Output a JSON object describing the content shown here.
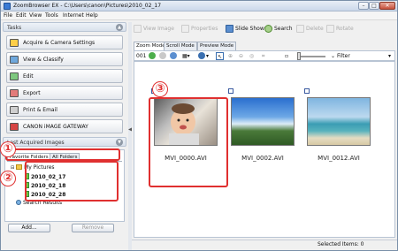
{
  "window": {
    "title": "ZoomBrowser EX - C:\\Users\\canon\\Pictures\\2010_02_17",
    "controls": {
      "minimize": "–",
      "maximize": "□",
      "close": "✕"
    }
  },
  "menu": [
    "File",
    "Edit",
    "View",
    "Tools",
    "Internet",
    "Help"
  ],
  "tasks": {
    "header": "Tasks",
    "items": [
      {
        "label": "Acquire & Camera Settings",
        "icon": "camera-icon"
      },
      {
        "label": "View & Classify",
        "icon": "view-classify-icon"
      },
      {
        "label": "Edit",
        "icon": "edit-icon"
      },
      {
        "label": "Export",
        "icon": "export-icon"
      },
      {
        "label": "Print & Email",
        "icon": "printer-icon"
      },
      {
        "label": "CANON iMAGE GATEWAY",
        "icon": "gateway-icon"
      }
    ]
  },
  "last_acquired": {
    "header": "Last Acquired Images"
  },
  "folders": {
    "tabs": [
      "Favorite Folders",
      "All Folders"
    ],
    "tree": {
      "root": "My Pictures",
      "children": [
        "2010_02_17",
        "2010_02_18",
        "2010_02_28"
      ],
      "search": "Search Results"
    },
    "add_label": "Add...",
    "remove_label": "Remove"
  },
  "toolbar": {
    "view_image": "View Image",
    "properties": "Properties",
    "slide_show": "Slide Show",
    "search": "Search",
    "delete": "Delete",
    "rotate": "Rotate"
  },
  "modes": [
    "Zoom Mode",
    "Scroll Mode",
    "Preview Mode"
  ],
  "view_toolbar": {
    "counter": "001",
    "filter_label": "Filter"
  },
  "thumbnails": [
    {
      "name": "MVI_0000.AVI"
    },
    {
      "name": "MVI_0002.AVI"
    },
    {
      "name": "MVI_0012.AVI"
    }
  ],
  "status": {
    "selected_items": "Selected Items: 0"
  },
  "callouts": [
    "①",
    "②",
    "③"
  ],
  "colors": {
    "callout": "#e03030",
    "accent": "#3a7bd5"
  }
}
